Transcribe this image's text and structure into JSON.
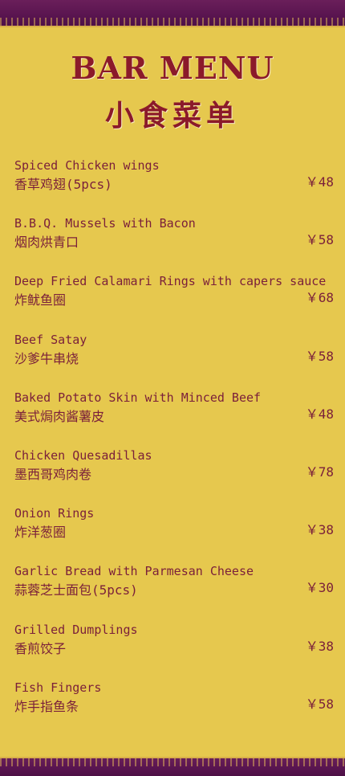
{
  "header": {
    "title": "BAR MENU",
    "subtitle": "小食菜单"
  },
  "items": [
    {
      "en": "Spiced Chicken wings",
      "zh": "香草鸡翅(5pcs)",
      "price": "￥48"
    },
    {
      "en": "B.B.Q. Mussels with Bacon",
      "zh": "烟肉烘青口",
      "price": "￥58"
    },
    {
      "en": "Deep Fried Calamari Rings with capers sauce",
      "zh": "炸鱿鱼圈",
      "price": "￥68"
    },
    {
      "en": "Beef Satay",
      "zh": "沙爹牛串烧",
      "price": "￥58"
    },
    {
      "en": "Baked Potato Skin with Minced Beef",
      "zh": "美式焗肉酱薯皮",
      "price": "￥48"
    },
    {
      "en": "Chicken Quesadillas",
      "zh": "墨西哥鸡肉卷",
      "price": "￥78"
    },
    {
      "en": "Onion Rings",
      "zh": "炸洋葱圈",
      "price": "￥38"
    },
    {
      "en": "Garlic Bread with Parmesan Cheese",
      "zh": "蒜蓉芝士面包(5pcs)",
      "price": "￥30"
    },
    {
      "en": "Grilled Dumplings",
      "zh": "香煎饺子",
      "price": "￥38"
    },
    {
      "en": "Fish Fingers",
      "zh": "炸手指鱼条",
      "price": "￥58"
    }
  ],
  "colors": {
    "background": "#e6c84e",
    "band": "#5a1550",
    "title": "#8b1a2a",
    "text": "#7a1f3a"
  }
}
